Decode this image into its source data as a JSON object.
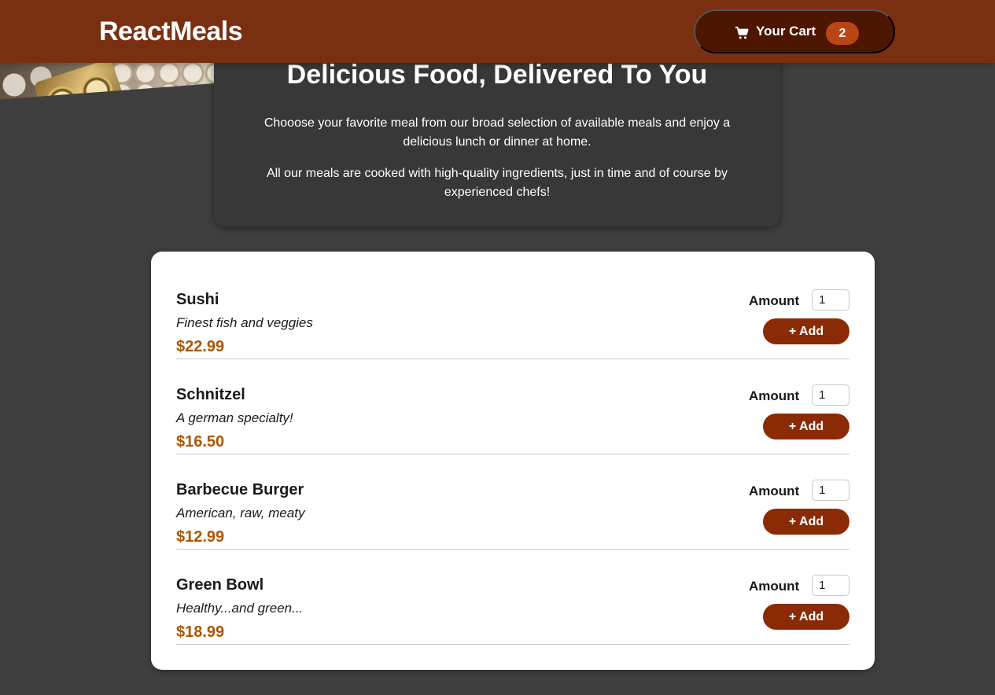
{
  "header": {
    "brand": "ReactMeals",
    "cart": {
      "label": "Your Cart",
      "count": "2",
      "icon": "cart-icon"
    }
  },
  "summary": {
    "title": "Delicious Food, Delivered To You",
    "paragraph1": "Chooose your favorite meal from our broad selection of available meals and enjoy a delicious lunch or dinner at home.",
    "paragraph2": "All our meals are cooked with high-quality ingredients, just in time and of course by experienced chefs!"
  },
  "meals": [
    {
      "name": "Sushi",
      "description": "Finest fish and veggies",
      "price": "$22.99",
      "amount_label": "Amount",
      "amount_value": "1",
      "add_label": "+ Add"
    },
    {
      "name": "Schnitzel",
      "description": "A german specialty!",
      "price": "$16.50",
      "amount_label": "Amount",
      "amount_value": "1",
      "add_label": "+ Add"
    },
    {
      "name": "Barbecue Burger",
      "description": "American, raw, meaty",
      "price": "$12.99",
      "amount_label": "Amount",
      "amount_value": "1",
      "add_label": "+ Add"
    },
    {
      "name": "Green Bowl",
      "description": "Healthy...and green...",
      "price": "$18.99",
      "amount_label": "Amount",
      "amount_value": "1",
      "add_label": "+ Add"
    }
  ],
  "colors": {
    "header_bg": "#7b2f11",
    "cart_bg": "#4d1601",
    "badge_bg": "#b94517",
    "button_bg": "#8a2b06",
    "price": "#ad5502",
    "page_bg": "#3f3f3f"
  }
}
